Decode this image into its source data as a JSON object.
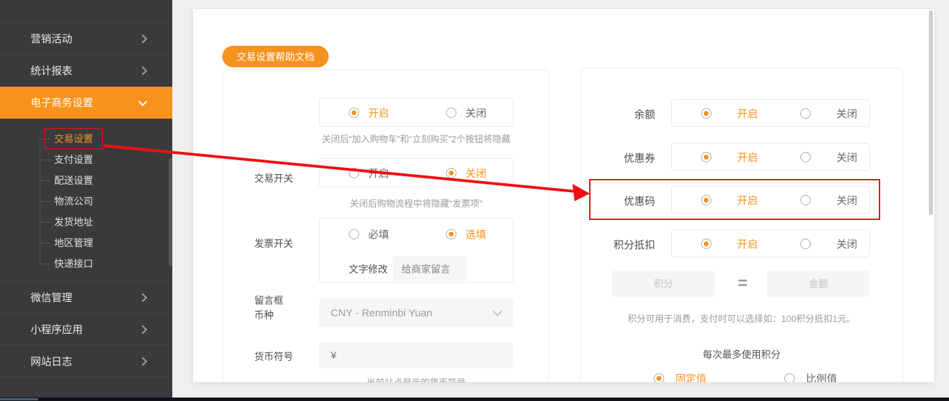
{
  "sidebar": {
    "items": [
      {
        "label": "营销活动"
      },
      {
        "label": "统计报表"
      },
      {
        "label": "电子商务设置"
      },
      {
        "label": "微信管理"
      },
      {
        "label": "小程序应用"
      },
      {
        "label": "网站日志"
      }
    ],
    "submenu": [
      {
        "label": "交易设置"
      },
      {
        "label": "支付设置"
      },
      {
        "label": "配送设置"
      },
      {
        "label": "物流公司"
      },
      {
        "label": "发货地址"
      },
      {
        "label": "地区管理"
      },
      {
        "label": "快递接口"
      }
    ]
  },
  "toolbar": {
    "help_button": "交易设置帮助文档"
  },
  "trade_panel": {
    "trade_switch": {
      "label": "交易开关",
      "on": "开启",
      "off": "关闭",
      "selected": "开启",
      "help": "关闭后“加入购物车”和“立刻购买”2个按钮将隐藏"
    },
    "invoice_switch": {
      "label": "发票开关",
      "on": "开启",
      "off": "关闭",
      "selected": "关闭",
      "help": "关闭后购物流程中将隐藏“发票项”"
    },
    "message_box": {
      "label": "留言框",
      "required": "必填",
      "optional": "选填",
      "selected": "选填",
      "edit_label": "文字修改",
      "placeholder": "给商家留言"
    },
    "currency": {
      "label": "币种",
      "value": "CNY - Renminbi Yuan"
    },
    "currency_symbol": {
      "label": "货币符号",
      "value": "¥",
      "help": "当前站点显示的货币符号"
    }
  },
  "promo_panel": {
    "balance": {
      "label": "余额",
      "on": "开启",
      "off": "关闭",
      "selected": "开启"
    },
    "coupon": {
      "label": "优惠券",
      "on": "开启",
      "off": "关闭",
      "selected": "开启"
    },
    "promo_code": {
      "label": "优惠码",
      "on": "开启",
      "off": "关闭",
      "selected": "开启"
    },
    "points_deduction": {
      "label": "积分抵扣",
      "on": "开启",
      "off": "关闭",
      "selected": "开启"
    },
    "points_input": {
      "placeholder": "积分"
    },
    "equals": "=",
    "amount_input": {
      "placeholder": "金额"
    },
    "points_help": "积分可用于消费，支付时可以选择如：100积分抵扣1元。",
    "max_points_label": "每次最多使用积分",
    "max_points_fixed": "固定值",
    "max_points_ratio": "比例值",
    "max_points_selected": "固定值"
  },
  "colors": {
    "accent_orange": "#f6921e",
    "highlight_red": "#f01010"
  }
}
